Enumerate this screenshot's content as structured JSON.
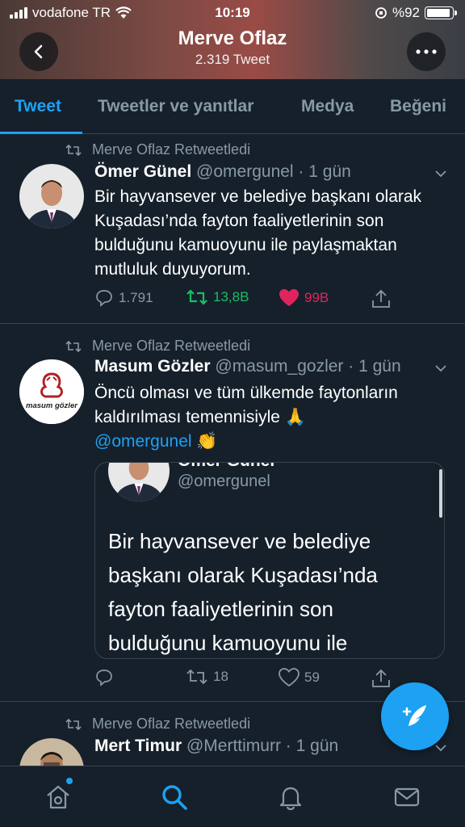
{
  "status": {
    "carrier": "vodafone TR",
    "time": "10:19",
    "battery": "%92",
    "battery_level": 0.92
  },
  "header": {
    "title": "Merve Oflaz",
    "subtitle": "2.319 Tweet"
  },
  "tabs": [
    {
      "label": "Tweet",
      "active": true
    },
    {
      "label": "Tweetler ve yanıtlar"
    },
    {
      "label": "Medya"
    },
    {
      "label": "Beğeni"
    }
  ],
  "tweets": [
    {
      "retweeted_by": "Merve Oflaz Retweetledi",
      "name": "Ömer Günel",
      "handle_time": "@omergunel · 1 gün",
      "text": "Bir hayvansever ve belediye başkanı olarak Kuşadası’nda fayton faaliyetlerinin son bulduğunu kamuoyunu ile paylaşmaktan mutluluk duyuyorum.",
      "replies": "1.791",
      "retweets": "13,8B",
      "likes": "99B"
    },
    {
      "retweeted_by": "Merve Oflaz Retweetledi",
      "name": "Masum Gözler",
      "handle_time": "@masum_gozler · 1 gün",
      "avatar_text": "masum gözler",
      "text_line1": "Öncü olması ve tüm ülkemde faytonların kaldırılması temennisiyle 🙏",
      "mention": "@omergunel",
      "emoji": "👏",
      "quote": {
        "name": "Ömer Günel",
        "handle": "@omergunel",
        "text": "Bir hayvansever ve belediye başkanı olarak Kuşadası’nda fayton faaliyetlerinin son bulduğunu kamuoyunu ile"
      },
      "replies": "",
      "retweets": "18",
      "likes": "59"
    },
    {
      "retweeted_by": "Merve Oflaz Retweetledi",
      "name": "Mert Timur",
      "handle_time": "@Merttimurr · 1 gün"
    }
  ],
  "colors": {
    "accent": "#1da1f2",
    "retweet": "#17bf63",
    "like": "#e0245e",
    "background": "#15202b"
  },
  "icons": [
    "back-icon",
    "more-icon",
    "reply-icon",
    "retweet-icon",
    "heart-icon",
    "share-icon",
    "compose-icon",
    "home-icon",
    "search-icon",
    "bell-icon",
    "mail-icon"
  ]
}
